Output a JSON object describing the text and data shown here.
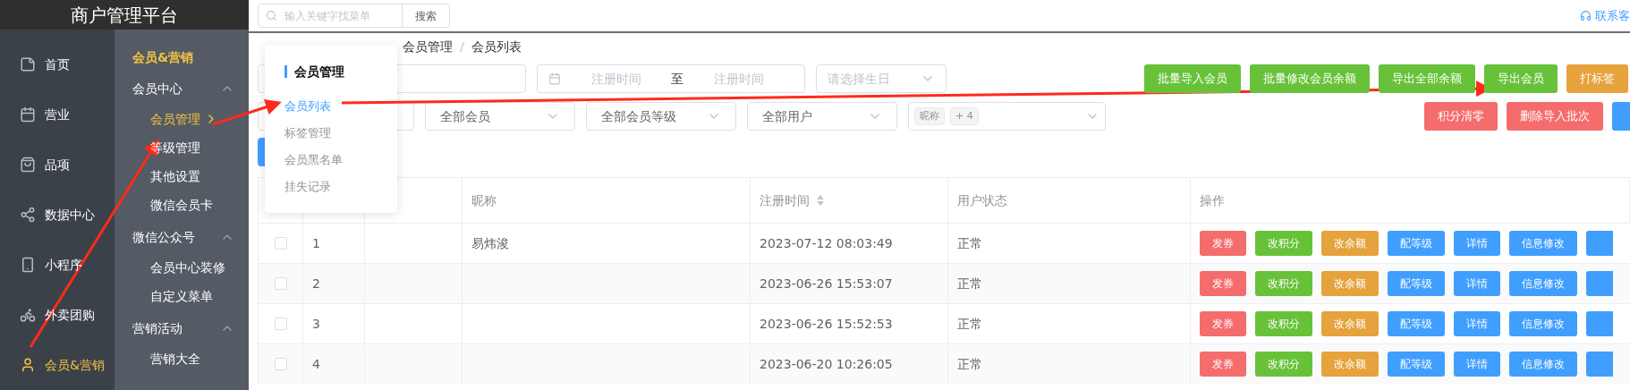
{
  "app": {
    "title": "商户管理平台"
  },
  "nav": [
    {
      "label": "首页",
      "selected": false
    },
    {
      "label": "营业",
      "selected": false
    },
    {
      "label": "品项",
      "selected": false
    },
    {
      "label": "数据中心",
      "selected": false
    },
    {
      "label": "小程序",
      "selected": false
    },
    {
      "label": "外卖团购",
      "selected": false
    },
    {
      "label": "会员&营销",
      "selected": true
    }
  ],
  "subnav": {
    "title": "会员&营销",
    "groups": [
      {
        "label": "会员中心",
        "expanded": true,
        "children": [
          {
            "label": "会员管理",
            "selected": true
          },
          {
            "label": "等级管理",
            "selected": false
          },
          {
            "label": "其他设置",
            "selected": false
          },
          {
            "label": "微信会员卡",
            "selected": false
          }
        ]
      },
      {
        "label": "微信公众号",
        "expanded": true,
        "children": [
          {
            "label": "会员中心装修",
            "selected": false
          },
          {
            "label": "自定义菜单",
            "selected": false
          }
        ]
      },
      {
        "label": "营销活动",
        "expanded": true,
        "children": [
          {
            "label": "营销大全",
            "selected": false
          }
        ]
      }
    ]
  },
  "topbar": {
    "search": {
      "placeholder": "输入关键字找菜单"
    },
    "search_button": "搜索",
    "contact": "联系客"
  },
  "breadcrumb": [
    "会员管理",
    "会员列表"
  ],
  "breadcrumb_separator": "/",
  "popup": {
    "title": "会员管理",
    "items": [
      {
        "label": "会员列表",
        "selected": true
      },
      {
        "label": "标签管理",
        "selected": false
      },
      {
        "label": "会员黑名单",
        "selected": false
      },
      {
        "label": "挂失记录",
        "selected": false
      }
    ]
  },
  "filters": {
    "date_range": {
      "start_placeholder": "注册时间",
      "separator": "至",
      "end_placeholder": "注册时间"
    },
    "birthday": {
      "placeholder": "请选择生日"
    },
    "selects": [
      {
        "value": "全部会员"
      },
      {
        "value": "全部会员等级"
      },
      {
        "value": "全部用户"
      }
    ],
    "multi": {
      "tags": [
        "昵称",
        "+ 4"
      ]
    }
  },
  "buttons_row1": [
    {
      "label": "批量导入会员",
      "kind": "success"
    },
    {
      "label": "批量修改会员余额",
      "kind": "success"
    },
    {
      "label": "导出全部余额",
      "kind": "success"
    },
    {
      "label": "导出会员",
      "kind": "success"
    },
    {
      "label": "打标签",
      "kind": "warning"
    }
  ],
  "buttons_row2": [
    {
      "label": "积分清零",
      "kind": "danger"
    },
    {
      "label": "删除导入批次",
      "kind": "danger"
    }
  ],
  "table": {
    "columns": [
      {
        "label": "昵称",
        "sortable": false
      },
      {
        "label": "注册时间",
        "sortable": true
      },
      {
        "label": "用户状态",
        "sortable": false
      },
      {
        "label": "操作",
        "sortable": false
      }
    ],
    "rows": [
      {
        "checked": false,
        "index": "1",
        "nickname": "易炜浚",
        "registered": "2023-07-12 08:03:49",
        "status": "正常",
        "actions": [
          {
            "label": "发券",
            "kind": "danger"
          },
          {
            "label": "改积分",
            "kind": "success"
          },
          {
            "label": "改余额",
            "kind": "warning"
          },
          {
            "label": "配等级",
            "kind": "primary"
          },
          {
            "label": "详情",
            "kind": "primary"
          },
          {
            "label": "信息修改",
            "kind": "primary"
          }
        ]
      },
      {
        "checked": false,
        "index": "2",
        "registered": "2023-06-26 15:53:07",
        "status": "正常",
        "actions": [
          {
            "label": "发券",
            "kind": "danger"
          },
          {
            "label": "改积分",
            "kind": "success"
          },
          {
            "label": "改余额",
            "kind": "warning"
          },
          {
            "label": "配等级",
            "kind": "primary"
          },
          {
            "label": "详情",
            "kind": "primary"
          },
          {
            "label": "信息修改",
            "kind": "primary"
          }
        ]
      },
      {
        "checked": false,
        "index": "3",
        "registered": "2023-06-26 15:52:53",
        "status": "正常",
        "actions": [
          {
            "label": "发券",
            "kind": "danger"
          },
          {
            "label": "改积分",
            "kind": "success"
          },
          {
            "label": "改余额",
            "kind": "warning"
          },
          {
            "label": "配等级",
            "kind": "primary"
          },
          {
            "label": "详情",
            "kind": "primary"
          },
          {
            "label": "信息修改",
            "kind": "primary"
          }
        ]
      },
      {
        "checked": false,
        "index": "4",
        "registered": "2023-06-20 10:26:05",
        "status": "正常",
        "actions": [
          {
            "label": "发券",
            "kind": "danger"
          },
          {
            "label": "改积分",
            "kind": "success"
          },
          {
            "label": "改余额",
            "kind": "warning"
          },
          {
            "label": "配等级",
            "kind": "primary"
          },
          {
            "label": "详情",
            "kind": "primary"
          },
          {
            "label": "信息修改",
            "kind": "primary"
          }
        ]
      }
    ]
  }
}
